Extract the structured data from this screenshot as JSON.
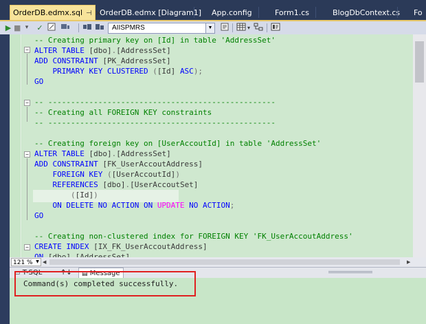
{
  "tabs": [
    {
      "label": "OrderDB.edmx.sql",
      "active": true,
      "pin": "⊣",
      "close": "×"
    },
    {
      "label": "OrderDB.edmx [Diagram1]"
    },
    {
      "label": "App.config"
    },
    {
      "label": "Form1.cs"
    },
    {
      "label": "BlogDbContext.cs"
    },
    {
      "label": "Fo"
    }
  ],
  "toolbar": {
    "database": "AIISPMRS"
  },
  "editor": {
    "lines": [
      {
        "parts": [
          {
            "t": "-- Creating primary key on [Id] in table 'AddressSet'",
            "c": "cm"
          }
        ]
      },
      {
        "parts": [
          {
            "t": "ALTER TABLE ",
            "c": "kw"
          },
          {
            "t": "[dbo]",
            "c": "ob"
          },
          {
            "t": ".",
            "c": "gy"
          },
          {
            "t": "[AddressSet]",
            "c": "ob"
          }
        ]
      },
      {
        "parts": [
          {
            "t": "ADD CONSTRAINT ",
            "c": "kw"
          },
          {
            "t": "[PK_AddressSet]",
            "c": "ob"
          }
        ]
      },
      {
        "parts": [
          {
            "t": "    PRIMARY KEY CLUSTERED ",
            "c": "kw"
          },
          {
            "t": "(",
            "c": "gy"
          },
          {
            "t": "[Id] ",
            "c": "ob"
          },
          {
            "t": "ASC",
            "c": "kw"
          },
          {
            "t": ");",
            "c": "gy"
          }
        ]
      },
      {
        "parts": [
          {
            "t": "GO",
            "c": "kw"
          }
        ]
      },
      {
        "parts": []
      },
      {
        "parts": [
          {
            "t": "-- --------------------------------------------------",
            "c": "cm"
          }
        ]
      },
      {
        "parts": [
          {
            "t": "-- Creating all FOREIGN KEY constraints",
            "c": "cm"
          }
        ]
      },
      {
        "parts": [
          {
            "t": "-- --------------------------------------------------",
            "c": "cm"
          }
        ]
      },
      {
        "parts": []
      },
      {
        "parts": [
          {
            "t": "-- Creating foreign key on [UserAccoutId] in table 'AddressSet'",
            "c": "cm"
          }
        ]
      },
      {
        "parts": [
          {
            "t": "ALTER TABLE ",
            "c": "kw"
          },
          {
            "t": "[dbo]",
            "c": "ob"
          },
          {
            "t": ".",
            "c": "gy"
          },
          {
            "t": "[AddressSet]",
            "c": "ob"
          }
        ]
      },
      {
        "parts": [
          {
            "t": "ADD CONSTRAINT ",
            "c": "kw"
          },
          {
            "t": "[FK_UserAccoutAddress]",
            "c": "ob"
          }
        ]
      },
      {
        "parts": [
          {
            "t": "    FOREIGN KEY ",
            "c": "kw"
          },
          {
            "t": "(",
            "c": "gy"
          },
          {
            "t": "[UserAccoutId]",
            "c": "ob"
          },
          {
            "t": ")",
            "c": "gy"
          }
        ]
      },
      {
        "parts": [
          {
            "t": "    REFERENCES ",
            "c": "kw"
          },
          {
            "t": "[dbo]",
            "c": "ob"
          },
          {
            "t": ".",
            "c": "gy"
          },
          {
            "t": "[UserAccoutSet]",
            "c": "ob"
          }
        ]
      },
      {
        "parts": [
          {
            "t": "        (",
            "c": "gy"
          },
          {
            "t": "[Id]",
            "c": "ob"
          },
          {
            "t": ")",
            "c": "gy"
          }
        ]
      },
      {
        "parts": [
          {
            "t": "    ON DELETE NO ACTION ON ",
            "c": "kw"
          },
          {
            "t": "UPDATE",
            "c": "pk"
          },
          {
            "t": " NO ACTION",
            "c": "kw"
          },
          {
            "t": ";",
            "c": "gy"
          }
        ]
      },
      {
        "parts": [
          {
            "t": "GO",
            "c": "kw"
          }
        ]
      },
      {
        "parts": []
      },
      {
        "parts": [
          {
            "t": "-- Creating non-clustered index for FOREIGN KEY 'FK_UserAccoutAddress'",
            "c": "cm"
          }
        ]
      },
      {
        "parts": [
          {
            "t": "CREATE INDEX ",
            "c": "kw"
          },
          {
            "t": "[IX_FK_UserAccoutAddress]",
            "c": "ob"
          }
        ]
      },
      {
        "parts": [
          {
            "t": "ON ",
            "c": "kw"
          },
          {
            "t": "[dbo]",
            "c": "ob"
          },
          {
            "t": ".",
            "c": "gy"
          },
          {
            "t": "[AddressSet]",
            "c": "ob"
          }
        ]
      }
    ]
  },
  "zoom": "121 %",
  "results": {
    "tabs": [
      {
        "label": "T-SQL"
      },
      {
        "label": "↑↓"
      },
      {
        "label": "Message",
        "active": true
      }
    ],
    "message": "Command(s) completed successfully."
  },
  "colors": {
    "keyword": "#0000ff",
    "comment": "#008000",
    "highlight_box": "#e02020",
    "active_tab": "#f7e39a",
    "editor_bg": "#c8e6c8"
  }
}
